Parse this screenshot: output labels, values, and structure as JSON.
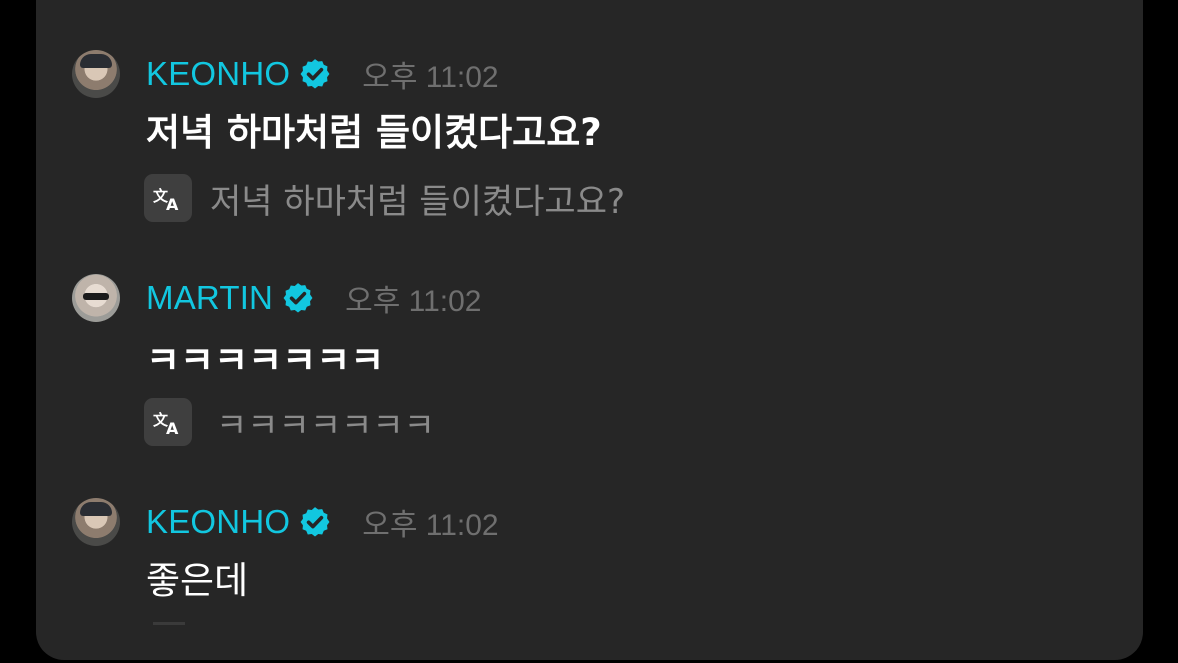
{
  "messages": [
    {
      "author": "KEONHO",
      "time": "오후 11:02",
      "text": "저녁 하마처럼 들이켰다고요?",
      "translation": "저녁 하마처럼 들이켰다고요?"
    },
    {
      "author": "MARTIN",
      "time": "오후 11:02",
      "text": "ㅋㅋㅋㅋㅋㅋㅋ",
      "translation": "ㅋㅋㅋㅋㅋㅋㅋ"
    },
    {
      "author": "KEONHO",
      "time": "오후 11:02",
      "text": "좋은데"
    }
  ],
  "colors": {
    "background": "#262626",
    "author_name": "#12c7e0",
    "verified_badge": "#12c7e0",
    "timestamp": "#6f6f6f",
    "translation_text": "#8a8a8a"
  },
  "icons": {
    "verified": "verified-badge-icon",
    "translate": "translate-icon"
  }
}
